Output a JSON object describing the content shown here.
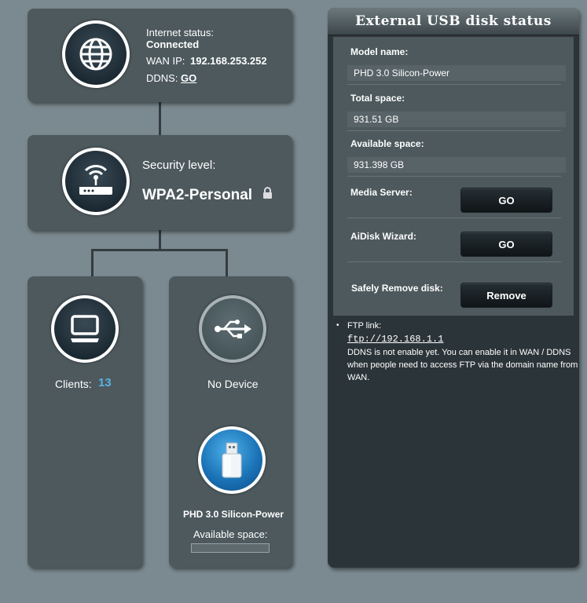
{
  "internet": {
    "status_label": "Internet status:",
    "status_value": "Connected",
    "wan_ip_label": "WAN IP:",
    "wan_ip_value": "192.168.253.252",
    "ddns_label": "DDNS:",
    "ddns_link": "GO",
    "icon": "globe-icon"
  },
  "security": {
    "label": "Security level:",
    "value": "WPA2-Personal",
    "icon": "router-icon",
    "lock_icon": "lock-icon"
  },
  "clients": {
    "label": "Clients:",
    "count": "13",
    "icon": "monitor-icon"
  },
  "usb": {
    "status": "No Device",
    "icon": "usb-icon",
    "disk_name": "PHD 3.0 Silicon-Power",
    "available_label": "Available space:",
    "disk_icon": "usb-drive-icon"
  },
  "panel": {
    "title": "External USB disk status",
    "model_label": "Model name:",
    "model_value": "PHD 3.0 Silicon-Power",
    "total_label": "Total space:",
    "total_value": "931.51 GB",
    "available_label": "Available space:",
    "available_value": "931.398 GB",
    "media_label": "Media Server:",
    "media_button": "GO",
    "aidisk_label": "AiDisk Wizard:",
    "aidisk_button": "GO",
    "remove_label": "Safely Remove disk:",
    "remove_button": "Remove",
    "ftp_label": "FTP link:",
    "ftp_value": "ftp://192.168.1.1",
    "ddns_note": "DDNS is not enable yet. You can enable it in WAN / DDNS when people need to access FTP via the domain name from WAN."
  },
  "colors": {
    "background": "#7b8a90",
    "card": "#4d595d",
    "client_count": "#5ab1e0"
  }
}
